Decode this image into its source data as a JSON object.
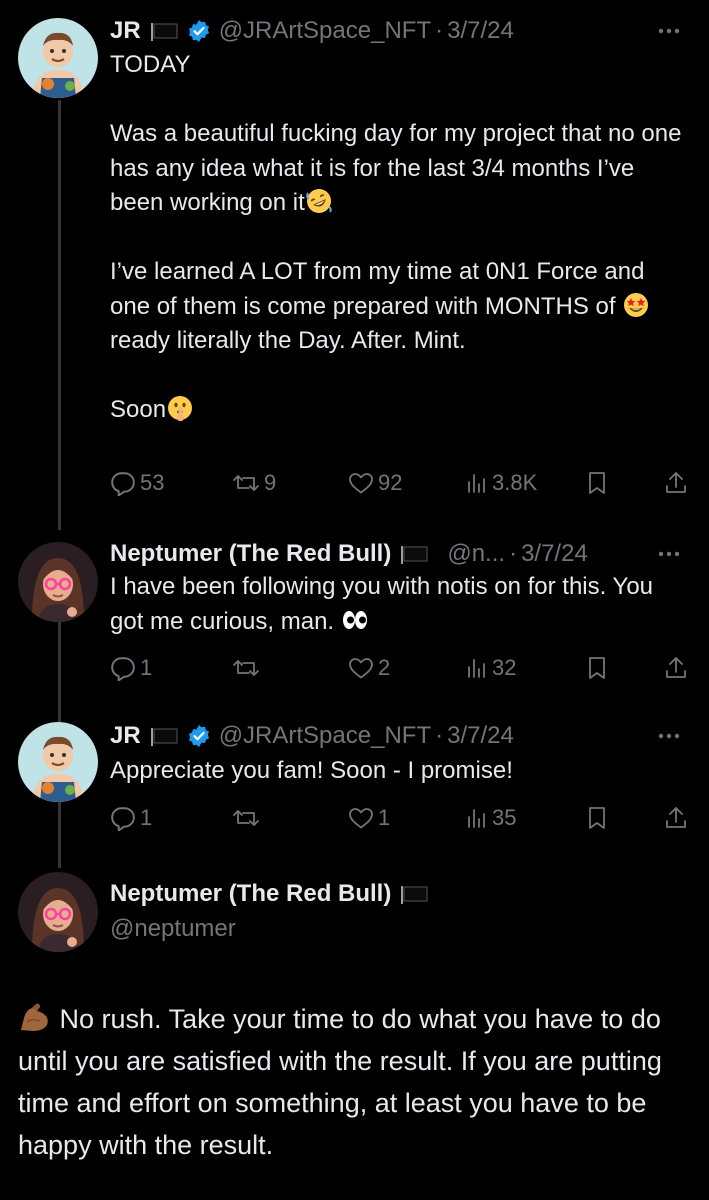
{
  "thread": [
    {
      "author_name": "JR",
      "handle": "@JRArtSpace_NFT",
      "date": "3/7/24",
      "verified": true,
      "paragraphs": [
        "TODAY",
        "",
        "Was a beautiful fucking day for my project that no one has any idea what it is for the last 3/4 months I’ve been working on it",
        "",
        "I’ve learned A LOT from my time at 0N1 Force and one of them is come prepared with MONTHS of",
        "",
        "Soon"
      ],
      "text_parts": {
        "line1": "TODAY",
        "para2": "Was a beautiful fucking day for my project that no one has any idea what it is for the last 3/4 months I’ve been working on it",
        "para3_a": "I’ve learned A LOT from my time at 0N1 Force and one of them is come prepared with MONTHS of",
        "para3_b": "ready literally the Day. After. Mint.",
        "para4": "Soon"
      },
      "stats": {
        "replies": "53",
        "reposts": "9",
        "likes": "92",
        "views": "3.8K"
      },
      "emojis": [
        "rolling-on-floor-laughing",
        "star-struck",
        "shushing-face"
      ]
    },
    {
      "author_name": "Neptumer (The Red Bull)",
      "handle": "@n...",
      "date": "3/7/24",
      "text": "I have been following you with notis on for this. You got me curious, man.",
      "stats": {
        "replies": "1",
        "reposts": "",
        "likes": "2",
        "views": "32"
      },
      "emojis": [
        "eyes"
      ]
    },
    {
      "author_name": "JR",
      "handle": "@JRArtSpace_NFT",
      "date": "3/7/24",
      "verified": true,
      "text": "Appreciate you fam! Soon - I promise!",
      "stats": {
        "replies": "1",
        "reposts": "",
        "likes": "1",
        "views": "35"
      }
    }
  ],
  "focused": {
    "author_name": "Neptumer (The Red Bull)",
    "handle": "@neptumer",
    "text": "No rush. Take your time to do what you have to do until you are satisfied with the result. If you are putting time and effort on something, at least you have to be happy with the result.",
    "emojis": [
      "flexed-biceps"
    ]
  },
  "separator": "·",
  "icons": [
    "more-icon",
    "verified-badge-icon",
    "flag-icon",
    "reply-icon",
    "repost-icon",
    "like-icon",
    "views-icon",
    "bookmark-icon",
    "share-icon"
  ],
  "colors": {
    "background": "#000000",
    "text": "#e7e9ea",
    "secondary": "#71767b",
    "verified": "#1d9bf0",
    "thread_line": "#333639"
  }
}
